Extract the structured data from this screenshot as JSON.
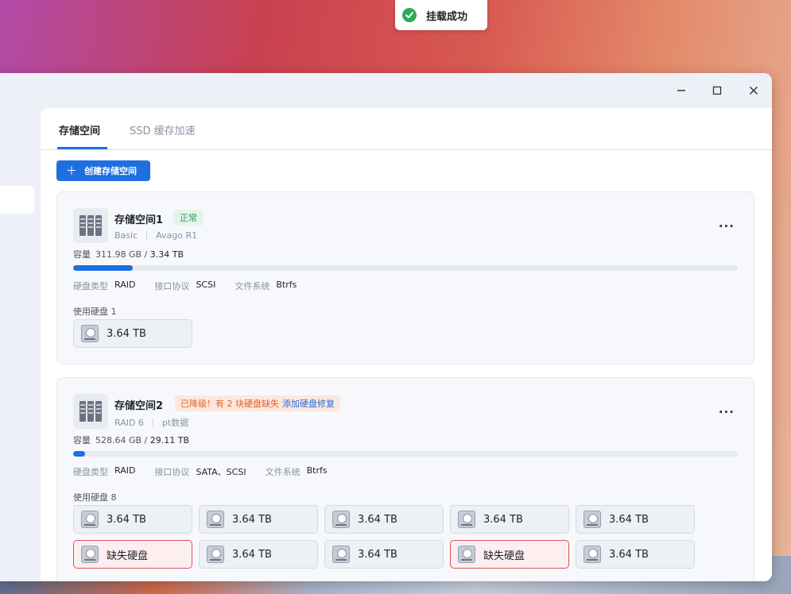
{
  "toast": {
    "text": "挂载成功",
    "icon": "check-circle-icon",
    "color": "#2eab57"
  },
  "window": {
    "minimize": "—",
    "maximize": "☐",
    "close": "✕"
  },
  "tabs": [
    {
      "label": "存储空间",
      "active": true
    },
    {
      "label": "SSD 缓存加速",
      "active": false
    }
  ],
  "create_button": {
    "plus": "＋",
    "label": "创建存储空间"
  },
  "pools": [
    {
      "name": "存储空间1",
      "status": "正常",
      "type": "Basic",
      "desc": "Avago R1",
      "capacity_label": "容量",
      "used": "311.98 GB",
      "total": "3.34 TB",
      "usage_fraction": 0.09,
      "props": [
        {
          "k": "硬盘类型",
          "v": "RAID"
        },
        {
          "k": "接口协议",
          "v": "SCSI"
        },
        {
          "k": "文件系统",
          "v": "Btrfs"
        }
      ],
      "disks_label": "使用硬盘 1",
      "disks": [
        {
          "label": "3.64 TB",
          "missing": false
        }
      ]
    },
    {
      "name": "存储空间2",
      "status_warn": "已降级！有 2 块硬盘缺失",
      "status_fix": "添加硬盘修复",
      "type": "RAID 6",
      "desc": "pt数据",
      "capacity_label": "容量",
      "used": "528.64 GB",
      "total": "29.11 TB",
      "usage_fraction": 0.018,
      "props": [
        {
          "k": "硬盘类型",
          "v": "RAID"
        },
        {
          "k": "接口协议",
          "v": "SATA、SCSI"
        },
        {
          "k": "文件系统",
          "v": "Btrfs"
        }
      ],
      "disks_label": "使用硬盘 8",
      "disks": [
        {
          "label": "3.64 TB",
          "missing": false
        },
        {
          "label": "3.64 TB",
          "missing": false
        },
        {
          "label": "3.64 TB",
          "missing": false
        },
        {
          "label": "3.64 TB",
          "missing": false
        },
        {
          "label": "3.64 TB",
          "missing": false
        },
        {
          "label": "缺失硬盘",
          "missing": true
        },
        {
          "label": "3.64 TB",
          "missing": false
        },
        {
          "label": "3.64 TB",
          "missing": false
        },
        {
          "label": "缺失硬盘",
          "missing": true
        },
        {
          "label": "3.64 TB",
          "missing": false
        }
      ]
    }
  ],
  "more_glyph": "···"
}
